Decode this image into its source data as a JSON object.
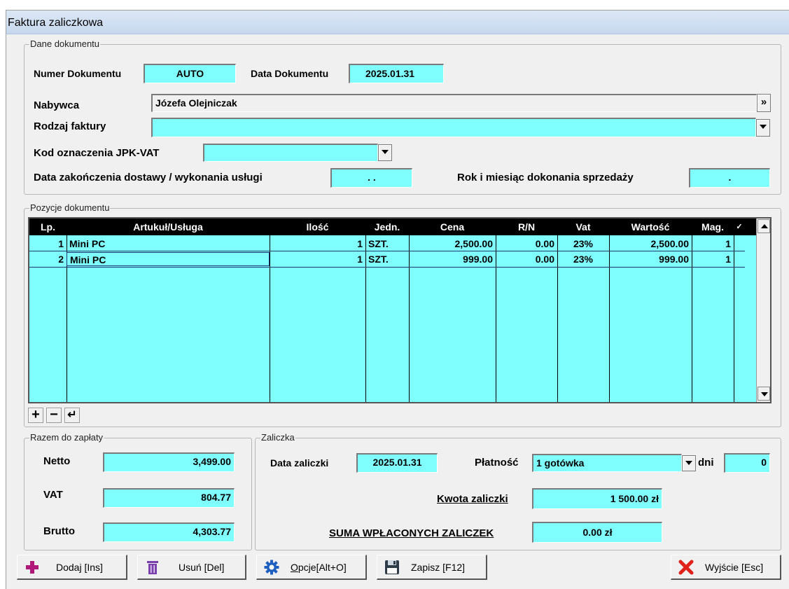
{
  "window": {
    "title": "Faktura zaliczkowa"
  },
  "doc": {
    "legend": "Dane dokumentu",
    "numer_label": "Numer Dokumentu",
    "numer_value": "AUTO",
    "data_label": "Data Dokumentu",
    "data_value": "2025.01.31",
    "nabywca_label": "Nabywca",
    "nabywca_value": "Józefa Olejniczak",
    "nabywca_btn": "»",
    "rodzaj_label": "Rodzaj faktury",
    "rodzaj_value": "",
    "jpk_label": "Kod oznaczenia JPK-VAT",
    "jpk_value": "",
    "dostawa_label": "Data zakończenia dostawy / wykonania usługi",
    "dostawa_value": ". .",
    "rok_label": "Rok i miesiąc dokonania sprzedaży",
    "rok_value": "."
  },
  "items": {
    "legend": "Pozycje dokumentu",
    "columns": [
      "Lp.",
      "Artukuł/Usługa",
      "Ilość",
      "Jedn.",
      "Cena",
      "R/N",
      "Vat",
      "Wartość",
      "Mag.",
      "✓"
    ],
    "rows": [
      {
        "lp": "1",
        "name": "Mini PC",
        "qty": "1",
        "unit": "SZT.",
        "price": "2,500.00",
        "rn": "0.00",
        "vat": "23%",
        "value": "2,500.00",
        "mag": "1"
      },
      {
        "lp": "2",
        "name": "Mini PC",
        "qty": "1",
        "unit": "SZT.",
        "price": "999.00",
        "rn": "0.00",
        "vat": "23%",
        "value": "999.00",
        "mag": "1"
      }
    ],
    "add_row": "+",
    "remove_row": "−",
    "enter_row": "↵"
  },
  "totals": {
    "legend": "Razem do zapłaty",
    "netto_label": "Netto",
    "netto_value": "3,499.00",
    "vat_label": "VAT",
    "vat_value": "804.77",
    "brutto_label": "Brutto",
    "brutto_value": "4,303.77"
  },
  "advance": {
    "legend": "Zaliczka",
    "data_label": "Data zaliczki",
    "data_value": "2025.01.31",
    "platnosc_label": "Płatność",
    "platnosc_value": "1 gotówka",
    "dni_label": "dni",
    "dni_value": "0",
    "kwota_label": "Kwota zaliczki",
    "kwota_value": "1 500.00 zł",
    "suma_label": "SUMA WPŁACONYCH ZALICZEK",
    "suma_value": "0.00 zł"
  },
  "buttons": {
    "dodaj": "Dodaj  [Ins]",
    "usun": "Usuń  [Del]",
    "opcje_first": "O",
    "opcje_rest": "pcje[Alt+O]",
    "zapisz": "Zapisz  [F12]",
    "wyjscie": "Wyjście [Esc]"
  },
  "colors": {
    "field_bg": "#80ffff",
    "header_bg": "#000000",
    "add": "#b0197a",
    "delete": "#7b3fb0",
    "exit": "#e0201a",
    "gear": "#1f5fbf"
  }
}
